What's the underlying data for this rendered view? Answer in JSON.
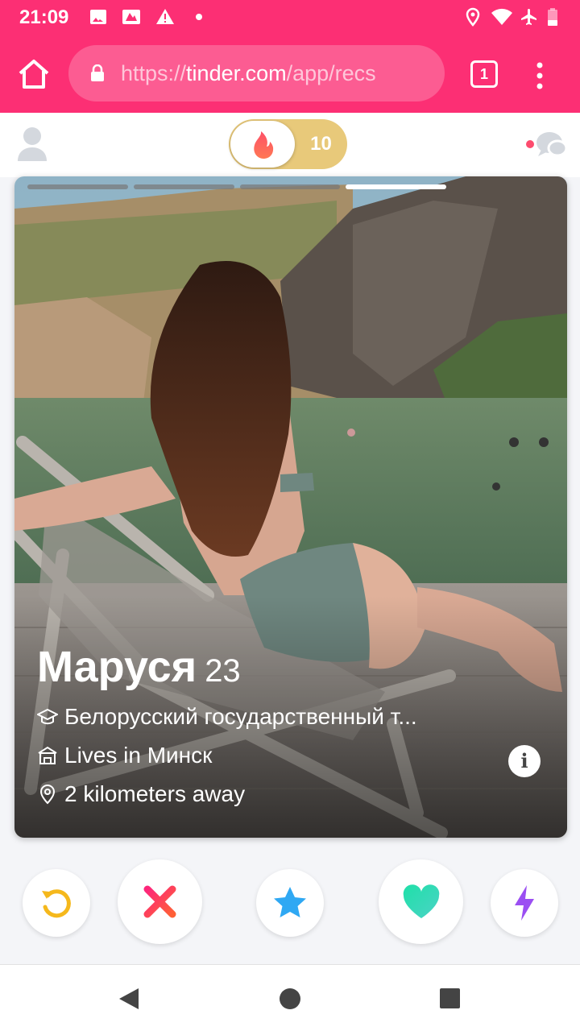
{
  "status_bar": {
    "time": "21:09",
    "icons": [
      "image-icon",
      "photo-icon",
      "warning-icon",
      "dot-icon",
      "location-icon",
      "wifi-icon",
      "airplane-icon",
      "battery-low-icon"
    ]
  },
  "browser": {
    "url_prefix": "https://",
    "url_host": "tinder.com",
    "url_path": "/app/recs",
    "tab_count": "1"
  },
  "header": {
    "super_count": "10"
  },
  "card": {
    "name": "Маруся",
    "age": "23",
    "school": "Белорусский государственный т...",
    "lives": "Lives in Минск",
    "distance": "2 kilometers away",
    "photo_count": 4,
    "active_photo": 4,
    "info_glyph": "i"
  },
  "actions": [
    "rewind-button",
    "nope-button",
    "super-like-button",
    "like-button",
    "boost-button"
  ],
  "colors": {
    "brand": "#fc2f74",
    "rewind": "#f5b81c",
    "nope": "#fd4c6e",
    "super_like": "#2fa8f3",
    "like": "#3ee2b6",
    "boost": "#9b4ff2",
    "gold": "#e8c97a"
  }
}
